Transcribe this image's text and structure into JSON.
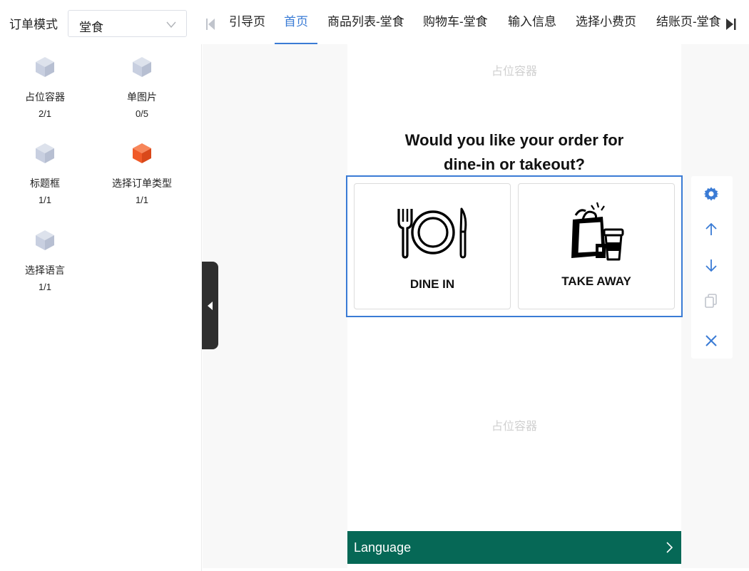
{
  "header": {
    "order_mode_label": "订单模式",
    "order_mode_value": "堂食",
    "tabs": [
      "引导页",
      "首页",
      "商品列表-堂食",
      "购物车-堂食",
      "输入信息",
      "选择小费页",
      "结账页-堂食"
    ],
    "active_tab": "首页"
  },
  "components": [
    {
      "name": "占位容器",
      "count": "2/1",
      "icon": "cube-icon",
      "color": "#c8cfe0"
    },
    {
      "name": "单图片",
      "count": "0/5",
      "icon": "cube-icon",
      "color": "#c8cfe0"
    },
    {
      "name": "标题框",
      "count": "1/1",
      "icon": "cube-icon",
      "color": "#c8cfe0"
    },
    {
      "name": "选择订单类型",
      "count": "1/1",
      "icon": "cube-icon",
      "color": "#f05a28"
    },
    {
      "name": "选择语言",
      "count": "1/1",
      "icon": "cube-icon",
      "color": "#c8cfe0"
    }
  ],
  "canvas": {
    "placeholder_top": "占位容器",
    "placeholder_bottom": "占位容器",
    "question_line1": "Would you like your order for",
    "question_line2": "dine-in or takeout?",
    "option_dine_in": "DINE IN",
    "option_take_away": "TAKE AWAY",
    "language_label": "Language"
  },
  "toolbar_icons": [
    "gear-icon",
    "arrow-up-icon",
    "arrow-down-icon",
    "copy-icon",
    "close-icon"
  ],
  "colors": {
    "accent": "#3a7bd5",
    "language_bar": "#066856",
    "active_component": "#f05a28"
  }
}
